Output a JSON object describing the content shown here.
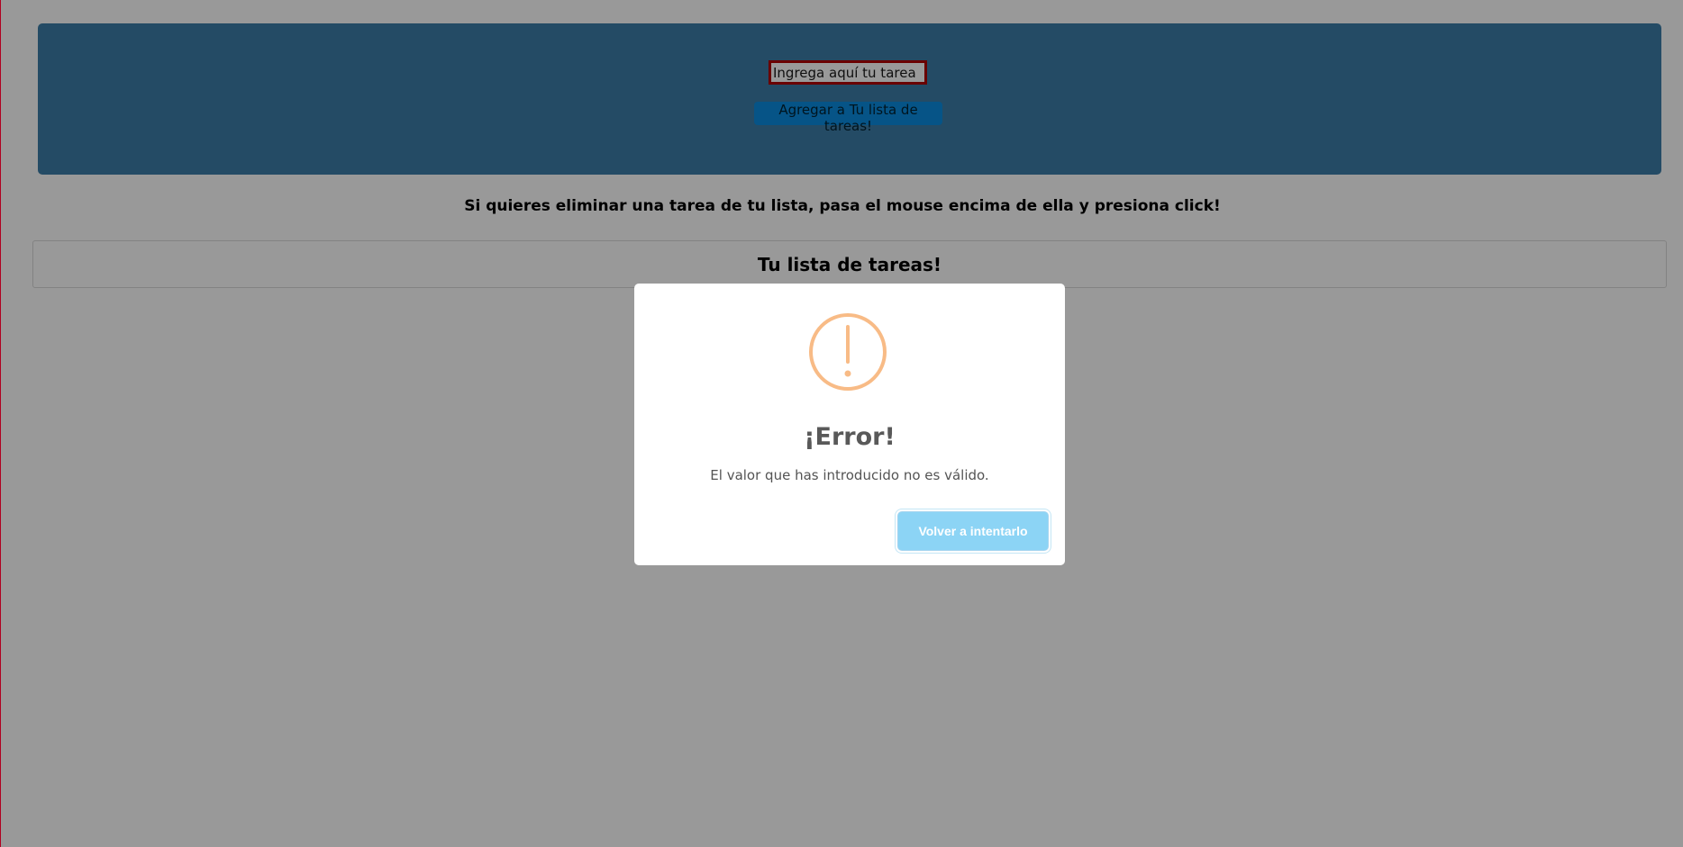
{
  "form": {
    "input_placeholder": "Ingrega aquí tu tarea",
    "input_value": "",
    "add_button_label": "Agregar a Tu lista de tareas!"
  },
  "instructions": "Si quieres eliminar una tarea de tu lista, pasa el mouse encima de ella y presiona click!",
  "task_list": {
    "title": "Tu lista de tareas!",
    "items": []
  },
  "modal": {
    "icon": "warning-circle-icon",
    "title": "¡Error!",
    "text": "El valor que has introducido no es válido.",
    "confirm_button_label": "Volver a intentarlo"
  },
  "colors": {
    "header_background": "#3c7ea8",
    "add_button": "#0b8de1",
    "input_border": "#b10000",
    "warning_icon": "#f8bb86",
    "confirm_button": "#8cd4f5",
    "overlay": "rgba(0,0,0,0.4)"
  }
}
